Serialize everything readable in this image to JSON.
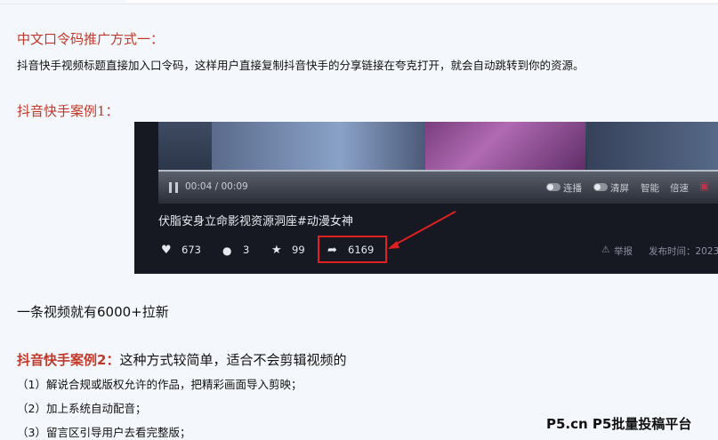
{
  "section1": {
    "heading": "中文口令码推广方式一：",
    "description": "抖音快手视频标题直接加入口令码，这样用户直接复制抖音快手的分享链接在夸克打开，就会自动跳转到你的资源。"
  },
  "case1": {
    "heading": "抖音快手案例1："
  },
  "video": {
    "time": "00:04 / 00:09",
    "controls": {
      "autoplay": "连播",
      "clear_screen": "清屏",
      "smart": "智能",
      "speed": "倍速"
    },
    "title": "伏脂安身立命影视资源洞座#动漫女神",
    "stats": {
      "likes": "673",
      "comments": "3",
      "favorites": "99",
      "shares": "6169"
    },
    "report": "举报",
    "publish_time": "发布时间：2023"
  },
  "result_text": "一条视频就有6000+拉新",
  "case2": {
    "label": "抖音快手案例2：",
    "description": "这种方式较简单，适合不会剪辑视频的",
    "steps": [
      "（1）解说合规或版权允许的作品，把精彩画面导入剪映；",
      "（2）加上系统自动配音；",
      "（3）留言区引导用户去看完整版；"
    ]
  },
  "watermark": "P5.cn P5批量投稿平台",
  "colors": {
    "accent_red": "#c0392b",
    "highlight_box": "#e02020"
  },
  "icons": [
    "pause-icon",
    "heart-icon",
    "comment-icon",
    "star-icon",
    "share-icon",
    "warning-icon",
    "danmaku-icon",
    "volume-icon"
  ]
}
